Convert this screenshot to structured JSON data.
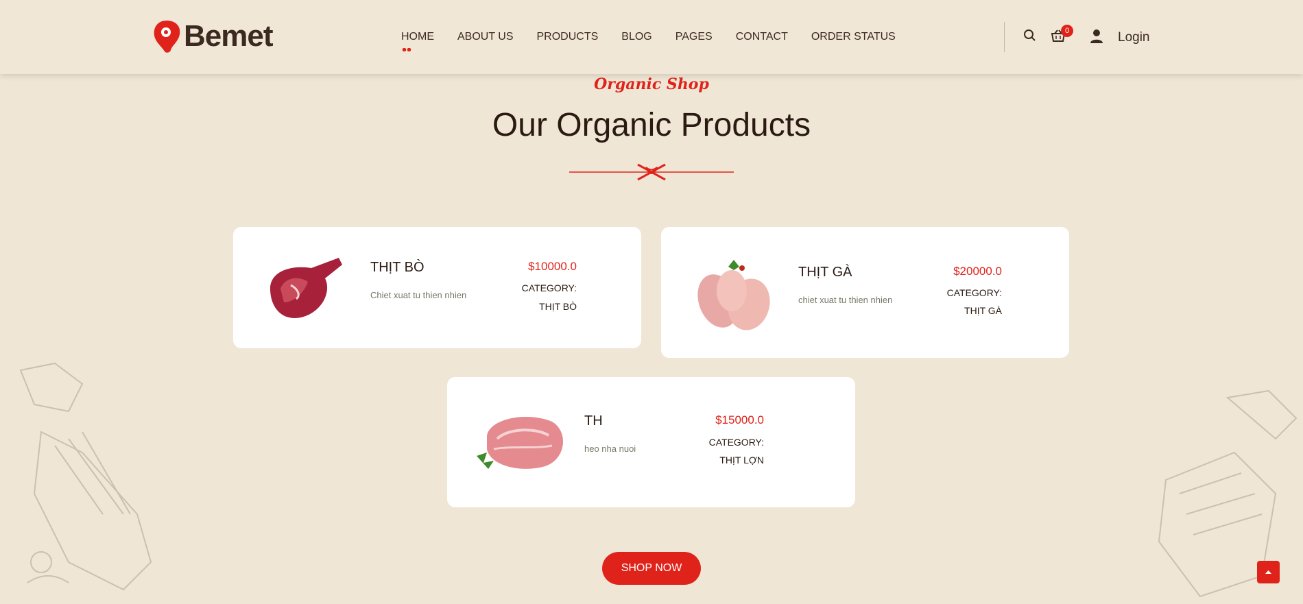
{
  "brand": {
    "name": "Bemet"
  },
  "nav": {
    "items": [
      "HOME",
      "ABOUT US",
      "PRODUCTS",
      "BLOG",
      "PAGES",
      "CONTACT",
      "ORDER STATUS"
    ]
  },
  "header": {
    "cart_count": "0",
    "login_label": "Login",
    "icons": [
      "search-icon",
      "cart-icon",
      "user-icon"
    ]
  },
  "section": {
    "subtitle": "Organic Shop",
    "title": "Our Organic Products"
  },
  "products": [
    {
      "name": "THỊT BÒ",
      "desc": "Chiet xuat tu thien nhien",
      "price": "$10000.0",
      "category_label": "CATEGORY:",
      "category": "THỊT BÒ"
    },
    {
      "name": "THỊT GÀ",
      "desc": "chiet xuat tu thien nhien",
      "price": "$20000.0",
      "category_label": "CATEGORY:",
      "category": "THỊT GÀ"
    },
    {
      "name": "TH",
      "desc": "heo nha nuoi",
      "price": "$15000.0",
      "category_label": "CATEGORY:",
      "category": "THỊT LỢN"
    }
  ],
  "cta": {
    "shop_now": "SHOP NOW"
  },
  "colors": {
    "accent": "#e0231a",
    "background": "#f0e6d6",
    "text": "#2a1a12"
  }
}
